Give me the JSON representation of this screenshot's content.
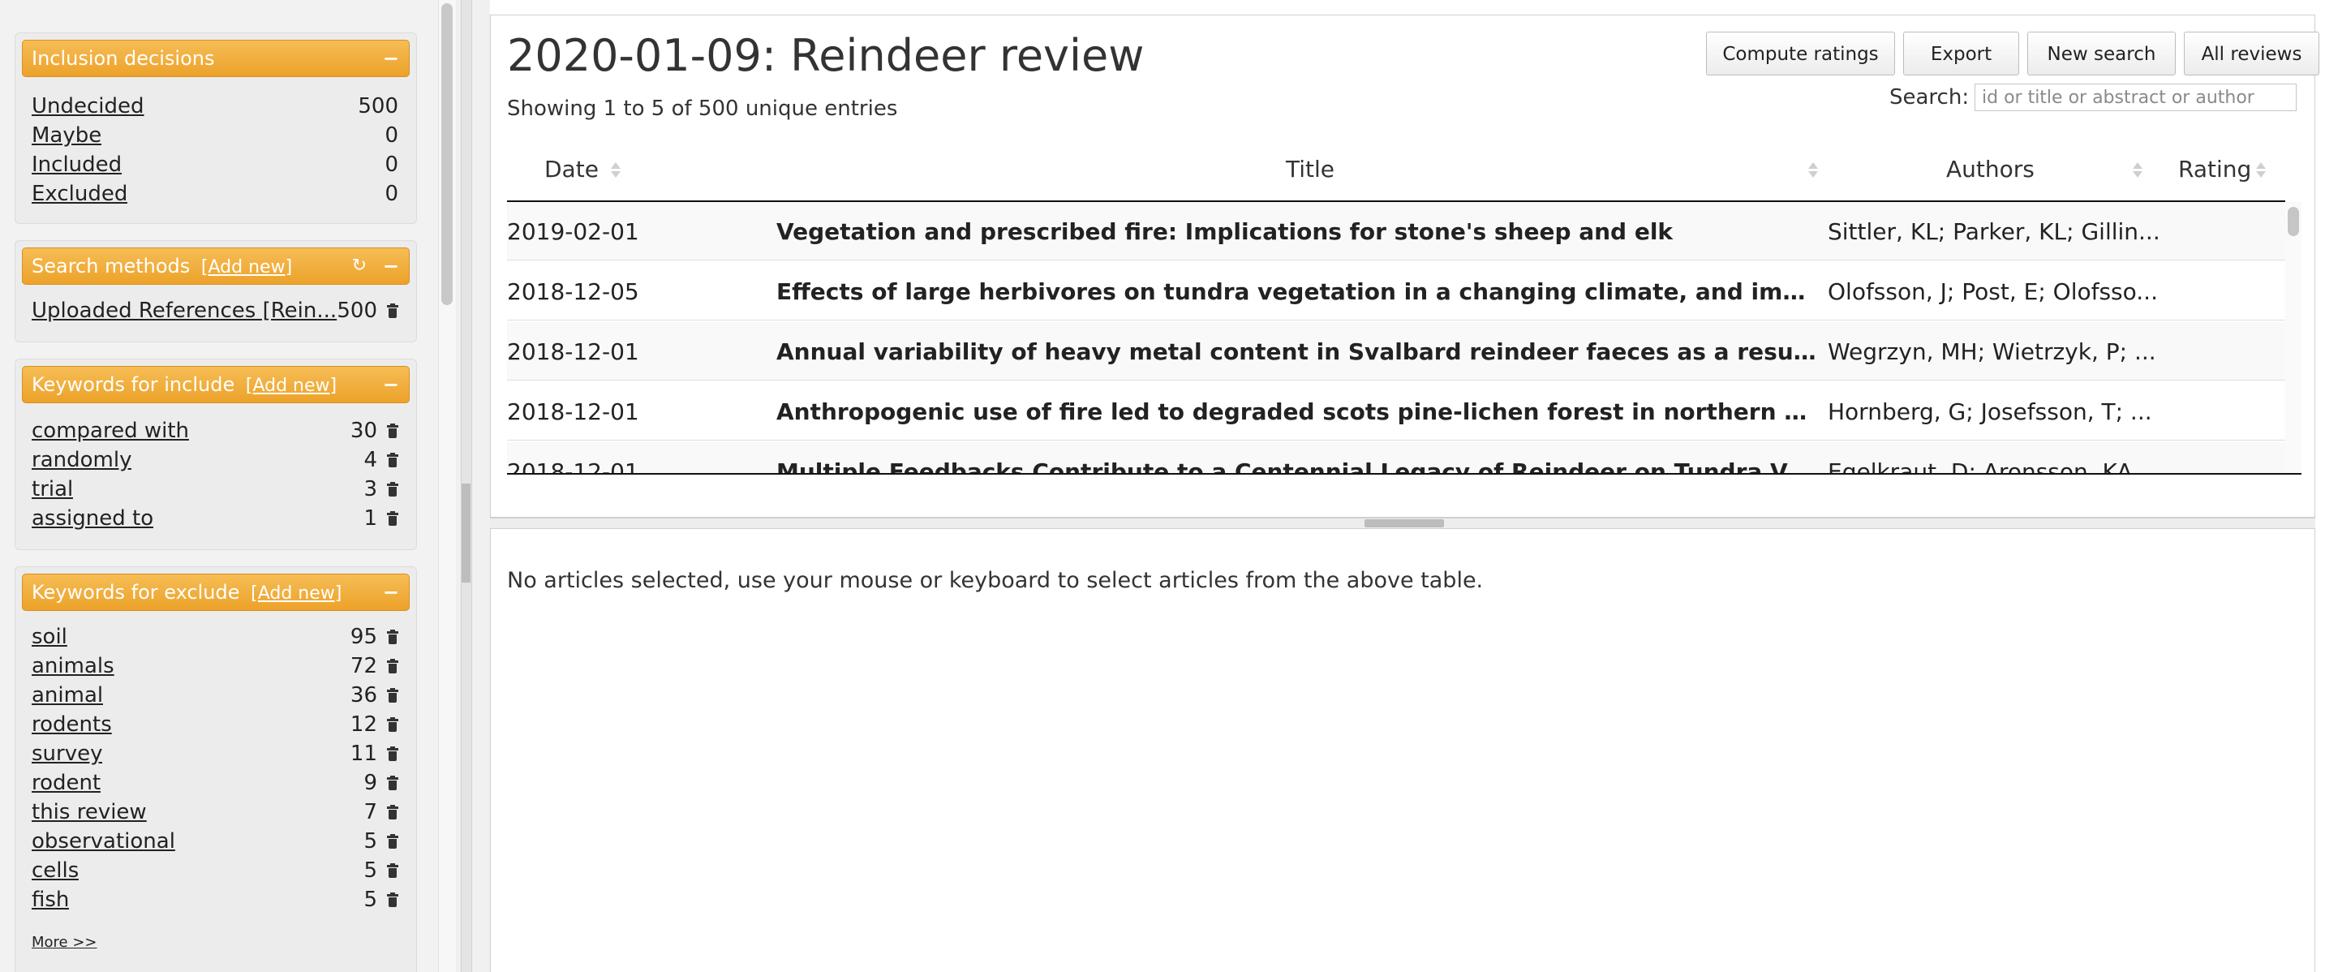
{
  "sidebar": {
    "inclusion": {
      "title": "Inclusion decisions",
      "collapse": "−",
      "items": [
        {
          "label": "Undecided",
          "count": "500"
        },
        {
          "label": "Maybe",
          "count": "0"
        },
        {
          "label": "Included",
          "count": "0"
        },
        {
          "label": "Excluded",
          "count": "0"
        }
      ]
    },
    "search_methods": {
      "title": "Search methods",
      "add_new": "[Add new]",
      "refresh_icon": "↻",
      "collapse": "−",
      "items": [
        {
          "label": "Uploaded References [Rein...",
          "count": "500"
        }
      ]
    },
    "keywords_include": {
      "title": "Keywords for include",
      "add_new": "[Add new]",
      "collapse": "−",
      "items": [
        {
          "label": "compared with",
          "count": "30"
        },
        {
          "label": "randomly",
          "count": "4"
        },
        {
          "label": "trial",
          "count": "3"
        },
        {
          "label": "assigned to",
          "count": "1"
        }
      ]
    },
    "keywords_exclude": {
      "title": "Keywords for exclude",
      "add_new": "[Add new]",
      "collapse": "−",
      "items": [
        {
          "label": "soil",
          "count": "95"
        },
        {
          "label": "animals",
          "count": "72"
        },
        {
          "label": "animal",
          "count": "36"
        },
        {
          "label": "rodents",
          "count": "12"
        },
        {
          "label": "survey",
          "count": "11"
        },
        {
          "label": "rodent",
          "count": "9"
        },
        {
          "label": "this review",
          "count": "7"
        },
        {
          "label": "observational",
          "count": "5"
        },
        {
          "label": "cells",
          "count": "5"
        },
        {
          "label": "fish",
          "count": "5"
        }
      ],
      "more": "More >>"
    }
  },
  "main": {
    "title": "2020-01-09: Reindeer review",
    "showing": "Showing 1 to 5 of 500 unique entries",
    "buttons": {
      "compute": "Compute ratings",
      "export": "Export",
      "new_search": "New search",
      "all_reviews": "All reviews"
    },
    "search": {
      "label": "Search:",
      "placeholder": "id or title or abstract or author",
      "value": ""
    },
    "table": {
      "columns": {
        "date": "Date",
        "title": "Title",
        "authors": "Authors",
        "rating": "Rating"
      },
      "rows": [
        {
          "date": "2019-02-01",
          "title": "Vegetation and prescribed fire: Implications for stone's sheep and elk",
          "authors": "Sittler, KL; Parker, KL; Gillin...",
          "rating": ""
        },
        {
          "date": "2018-12-05",
          "title": "Effects of large herbivores on tundra vegetation in a changing climate, and implications for rewilding",
          "authors": "Olofsson, J; Post, E; Olofsso...",
          "rating": ""
        },
        {
          "date": "2018-12-01",
          "title": "Annual variability of heavy metal content in Svalbard reindeer faeces as a result of dietary shifts",
          "authors": "Wegrzyn, MH; Wietrzyk, P; ...",
          "rating": ""
        },
        {
          "date": "2018-12-01",
          "title": "Anthropogenic use of fire led to degraded scots pine-lichen forest in northern Sweden",
          "authors": "Hornberg, G; Josefsson, T; ...",
          "rating": ""
        },
        {
          "date": "2018-12-01",
          "title": "Multiple Feedbacks Contribute to a Centennial Legacy of Reindeer on Tundra Vegetation",
          "authors": "Egelkraut, D; Aronsson, KA;...",
          "rating": ""
        }
      ]
    },
    "detail": {
      "message": "No articles selected, use your mouse or keyboard to select articles from the above table."
    }
  },
  "colors": {
    "panel_header": "#eca22a",
    "panel_header_border": "#d8901e"
  },
  "icons": {
    "trash": "trash-icon",
    "sort": "sort-icon",
    "refresh": "refresh-icon",
    "collapse": "collapse-icon"
  }
}
